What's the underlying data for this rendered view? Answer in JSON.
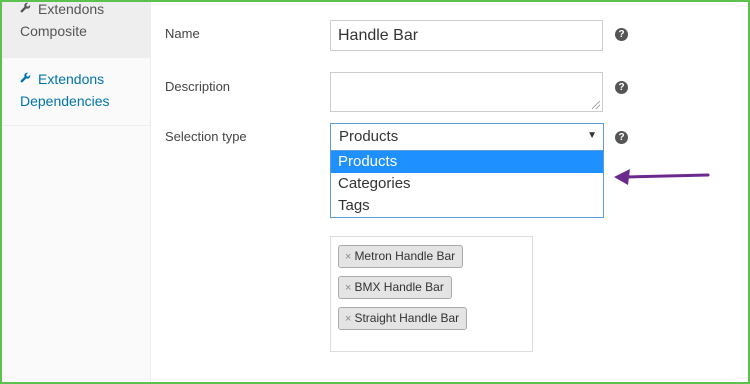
{
  "sidebar": {
    "items": [
      {
        "label_line1": "Extendons",
        "label_line2": "Composite",
        "icon": "wrench-icon"
      },
      {
        "label_line1": "Extendons",
        "label_line2": "Dependencies",
        "icon": "wrench-icon"
      }
    ]
  },
  "form": {
    "name": {
      "label": "Name",
      "value": "Handle Bar"
    },
    "description": {
      "label": "Description",
      "value": ""
    },
    "selection_type": {
      "label": "Selection type",
      "selected": "Products",
      "options": [
        "Products",
        "Categories",
        "Tags"
      ]
    },
    "help_glyph": "?",
    "tags": [
      {
        "remove": "×",
        "label": "Metron Handle Bar"
      },
      {
        "remove": "×",
        "label": "BMX Handle Bar"
      },
      {
        "remove": "×",
        "label": "Straight Handle Bar"
      }
    ]
  },
  "colors": {
    "frame_border": "#5cc24f",
    "link": "#0073aa",
    "option_highlight": "#1e90ff",
    "annotation_arrow": "#6b2a8c"
  }
}
